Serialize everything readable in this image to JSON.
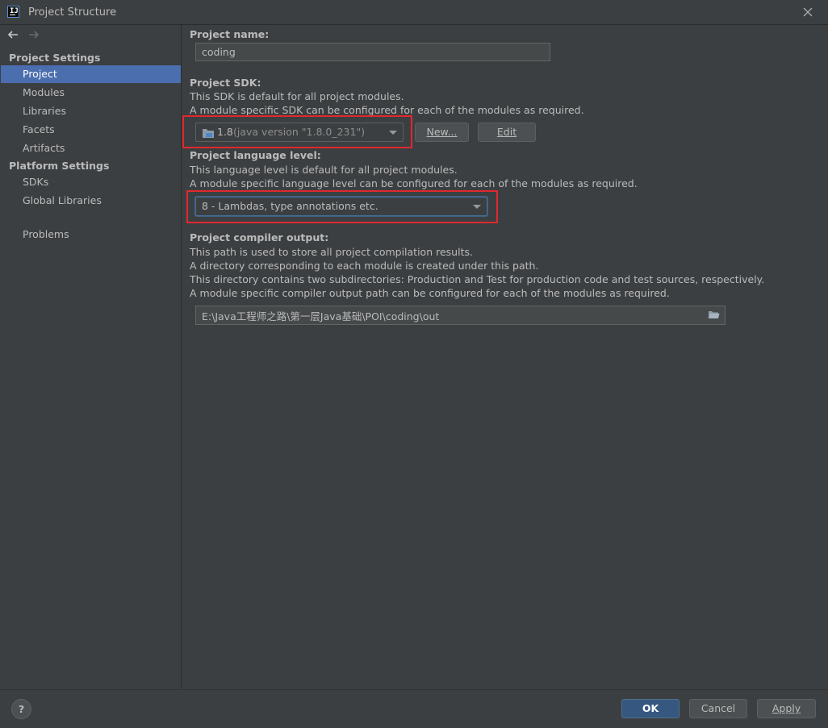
{
  "window": {
    "title": "Project Structure"
  },
  "sidebar": {
    "project_settings_title": "Project Settings",
    "project_settings_items": [
      "Project",
      "Modules",
      "Libraries",
      "Facets",
      "Artifacts"
    ],
    "platform_settings_title": "Platform Settings",
    "platform_settings_items": [
      "SDKs",
      "Global Libraries"
    ],
    "problems_label": "Problems"
  },
  "main": {
    "project_name_label": "Project name:",
    "project_name_value": "coding",
    "sdk_label": "Project SDK:",
    "sdk_desc_1": "This SDK is default for all project modules.",
    "sdk_desc_2": "A module specific SDK can be configured for each of the modules as required.",
    "sdk_selected_version": "1.8",
    "sdk_selected_detail": "(java version \"1.8.0_231\")",
    "sdk_new_button": "New...",
    "sdk_edit_button": "Edit",
    "lang_label": "Project language level:",
    "lang_desc_1": "This language level is default for all project modules.",
    "lang_desc_2": "A module specific language level can be configured for each of the modules as required.",
    "lang_selected": "8 - Lambdas, type annotations etc.",
    "output_label": "Project compiler output:",
    "output_desc_1": "This path is used to store all project compilation results.",
    "output_desc_2": "A directory corresponding to each module is created under this path.",
    "output_desc_3": "This directory contains two subdirectories: Production and Test for production code and test sources, respectively.",
    "output_desc_4": "A module specific compiler output path can be configured for each of the modules as required.",
    "output_path": "E:\\Java工程师之路\\第一层Java基础\\POI\\coding\\out"
  },
  "footer": {
    "help_label": "?",
    "ok_label": "OK",
    "cancel_label": "Cancel",
    "apply_label": "Apply"
  },
  "colors": {
    "background": "#3c3f41",
    "selection": "#4b6eaf",
    "primary_button": "#365880",
    "highlight_box": "#e0282e"
  }
}
